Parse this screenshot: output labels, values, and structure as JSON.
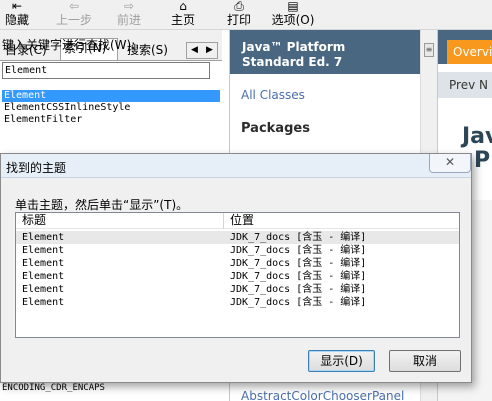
{
  "toolbar": {
    "buttons": [
      {
        "label": "隐藏",
        "icon": "hide-icon",
        "glyph": "⇤",
        "enabled": true
      },
      {
        "label": "上一步",
        "icon": "back-arrow-icon",
        "glyph": "⇦",
        "enabled": false
      },
      {
        "label": "前进",
        "icon": "forward-arrow-icon",
        "glyph": "⇨",
        "enabled": false
      },
      {
        "label": "主页",
        "icon": "home-icon",
        "glyph": "⌂",
        "enabled": true
      },
      {
        "label": "打印",
        "icon": "print-icon",
        "glyph": "⎙",
        "enabled": true
      },
      {
        "label": "选项(O)",
        "icon": "options-icon",
        "glyph": "▤",
        "enabled": true
      }
    ]
  },
  "left_pane": {
    "tabs": [
      "目录(C)",
      "索引(N)",
      "搜索(S)"
    ],
    "active_tab": "索引(N)",
    "tab_scroll": [
      "◀",
      "▶"
    ],
    "keyword_label": "键入关键字进行查找(W):",
    "keyword_value": "Element",
    "index_items": [
      "Element",
      "ElementCSSInlineStyle",
      "ElementFilter"
    ],
    "selected_index_item": "Element",
    "index_bottom_items": [
      "ENCODING_CDR_ENCAPS"
    ]
  },
  "middle_pane": {
    "header_line1": "Java™ Platform",
    "header_line2": "Standard Ed. 7",
    "all_classes": "All Classes",
    "packages_title": "Packages",
    "bottom_link": "AbstractColorChooserPanel",
    "scroll_glyph": "≡"
  },
  "right_pane": {
    "overview_tab": "Overview",
    "prev_link": "Prev  N",
    "heading_fragment_1": "Jav",
    "heading_fragment_2": "P"
  },
  "dialog": {
    "title": "找到的主题",
    "close_glyph": "✕",
    "instruction": "单击主题，然后单击“显示”(T)。",
    "columns": [
      "标题",
      "位置"
    ],
    "rows": [
      {
        "title": "Element",
        "location": "JDK_7_docs [含玉 - 编译]"
      },
      {
        "title": "Element",
        "location": "JDK_7_docs [含玉 - 编译]"
      },
      {
        "title": "Element",
        "location": "JDK_7_docs [含玉 - 编译]"
      },
      {
        "title": "Element",
        "location": "JDK_7_docs [含玉 - 编译]"
      },
      {
        "title": "Element",
        "location": "JDK_7_docs [含玉 - 编译]"
      },
      {
        "title": "Element",
        "location": "JDK_7_docs [含玉 - 编译]"
      }
    ],
    "display_button": "显示(D)",
    "cancel_button": "取消"
  },
  "colors": {
    "java_header": "#4a6782",
    "overview_orange": "#f8981d",
    "selection_blue": "#3399ff",
    "link_blue": "#4a6ea9"
  }
}
